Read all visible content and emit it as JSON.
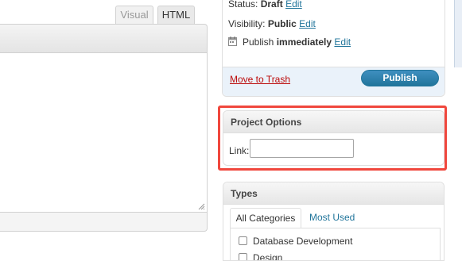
{
  "editor": {
    "tab_visual": "Visual",
    "tab_html": "HTML"
  },
  "publish": {
    "status_label": "Status:",
    "status_value": "Draft",
    "status_edit": "Edit",
    "visibility_label": "Visibility:",
    "visibility_value": "Public",
    "visibility_edit": "Edit",
    "publish_label": "Publish",
    "publish_value": "immediately",
    "publish_edit": "Edit",
    "trash_link": "Move to Trash",
    "publish_button": "Publish"
  },
  "project_options": {
    "title": "Project Options",
    "link_label": "Link:",
    "link_value": ""
  },
  "types": {
    "title": "Types",
    "tab_all": "All Categories",
    "tab_most_used": "Most Used",
    "categories": [
      "Database Development",
      "Design"
    ]
  },
  "colors": {
    "highlight": "#f0473d",
    "link": "#21759b",
    "trash": "#bc0b0b",
    "publish_button": "#21759b"
  }
}
